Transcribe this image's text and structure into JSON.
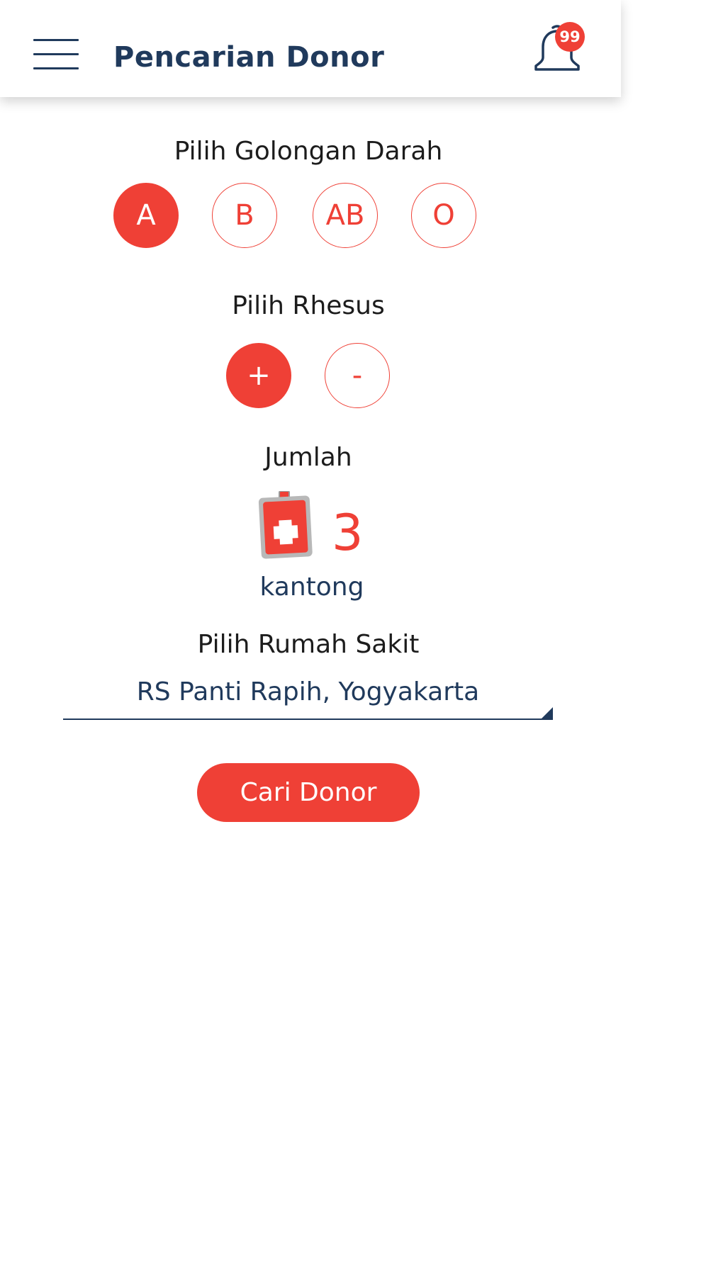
{
  "header": {
    "title": "Pencarian Donor",
    "notification_count": "99",
    "menu_icon": "hamburger-menu-icon",
    "notification_icon": "bell-icon"
  },
  "blood_type": {
    "label": "Pilih Golongan Darah",
    "options": [
      "A",
      "B",
      "AB",
      "O"
    ],
    "selected": "A"
  },
  "rhesus": {
    "label": "Pilih Rhesus",
    "options": [
      "+",
      "-"
    ],
    "selected": "+"
  },
  "quantity": {
    "label": "Jumlah",
    "value": "3",
    "unit": "kantong",
    "icon": "blood-bag-icon"
  },
  "hospital": {
    "label": "Pilih Rumah Sakit",
    "value": "RS Panti Rapih, Yogyakarta"
  },
  "actions": {
    "search_label": "Cari Donor"
  },
  "colors": {
    "accent": "#ef4036",
    "primary_text": "#203a5c",
    "heading_text": "#1c1c1c",
    "background": "#ffffff"
  }
}
